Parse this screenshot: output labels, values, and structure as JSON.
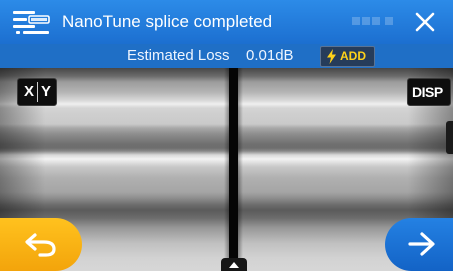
{
  "title_bar": {
    "title": "NanoTune splice completed",
    "app_icon": "fiber-splicer-icon",
    "close_icon": "close-icon"
  },
  "info_bar": {
    "loss_label": "Estimated Loss",
    "loss_value": "0.01dB",
    "add_label": "ADD",
    "add_icon": "lightning-bolt-icon"
  },
  "view_controls": {
    "xy_x": "X",
    "xy_y": "Y",
    "disp_label": "DISP"
  },
  "navigation": {
    "back_icon": "back-arrow-icon",
    "next_icon": "next-arrow-icon",
    "handle_icon": "chevron-up-icon"
  },
  "colors": {
    "title_blue": "#1c6fd0",
    "info_blue": "#1f6fc6",
    "add_text": "#ffd21a",
    "back_orange": "#f3a40b",
    "next_blue": "#1363c6"
  }
}
